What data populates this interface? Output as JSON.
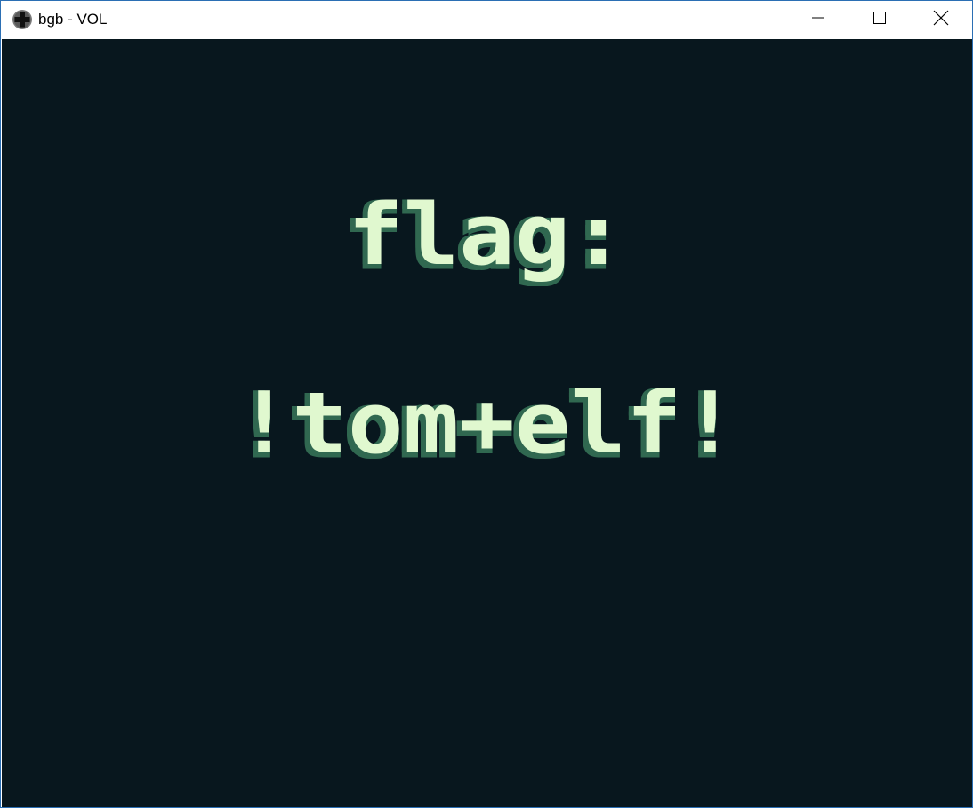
{
  "window": {
    "title": "bgb - VOL",
    "app_icon": "dpad-icon",
    "controls": {
      "minimize_icon": "minimize-icon",
      "maximize_icon": "maximize-icon",
      "close_icon": "close-icon"
    }
  },
  "screen": {
    "background": "#08171e",
    "text_color": "#e0f8cf",
    "shadow_color": "#306850",
    "line1": "flag:",
    "line2": "!tom+elf!"
  }
}
